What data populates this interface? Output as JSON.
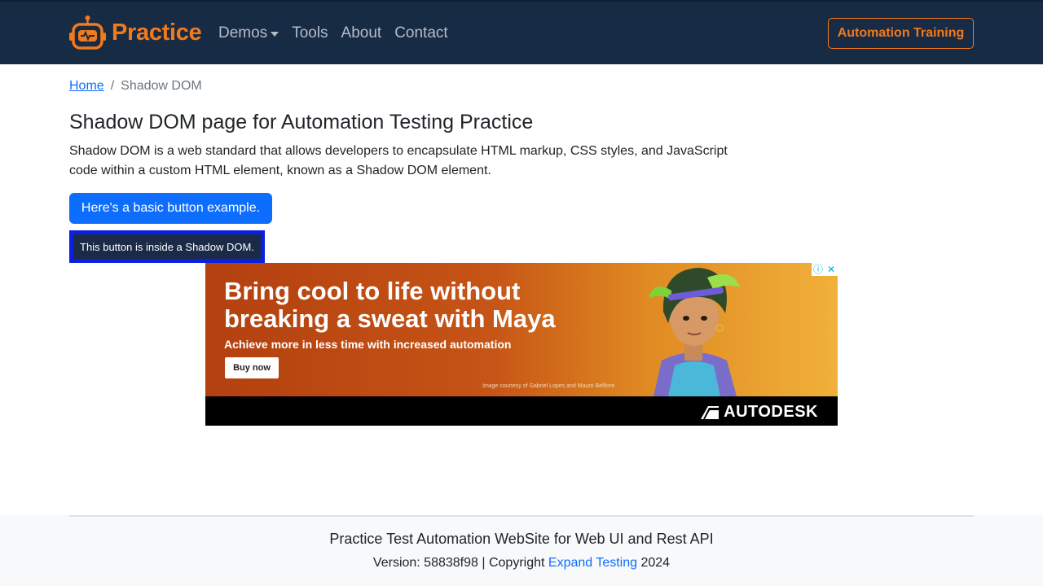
{
  "navbar": {
    "brand": "Practice",
    "brand_icon": "robot-logo-icon",
    "links": [
      "Demos",
      "Tools",
      "About",
      "Contact"
    ],
    "cta": "Automation Training",
    "accent_color": "#f27a1a",
    "background_color": "#182b45"
  },
  "breadcrumb": {
    "home": "Home",
    "separator": "/",
    "current": "Shadow DOM"
  },
  "main": {
    "title": "Shadow DOM page for Automation Testing Practice",
    "intro": "Shadow DOM is a web standard that allows developers to encapsulate HTML markup, CSS styles, and JavaScript code within a custom HTML element, known as a Shadow DOM element.",
    "basic_button": "Here's a basic button example.",
    "shadow_button": "This button is inside a Shadow DOM."
  },
  "ad": {
    "headline": "Bring cool to life without breaking a sweat with Maya",
    "subline": "Achieve more in less time with increased automation",
    "button": "Buy now",
    "credit": "Image courtesy of Gabriel Lopes and Mauro Belfiore",
    "brand": "AUTODESK",
    "info_icon": "ⓘ",
    "close_icon": "✕"
  },
  "footer": {
    "title": "Practice Test Automation WebSite for Web UI and Rest API",
    "version_prefix": "Version: 58838f98 | Copyright ",
    "company": "Expand Testing",
    "year": " 2024"
  }
}
